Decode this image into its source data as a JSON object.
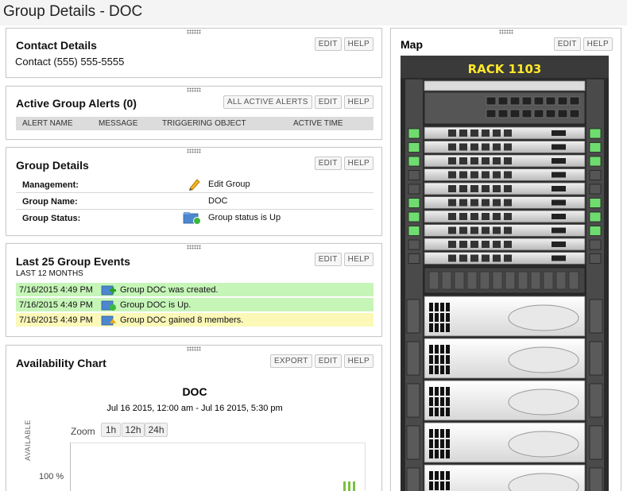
{
  "page": {
    "title": "Group Details - DOC"
  },
  "contact": {
    "title": "Contact Details",
    "edit_label": "EDIT",
    "help_label": "HELP",
    "line": "Contact (555) 555-5555"
  },
  "alerts": {
    "title": "Active Group Alerts (0)",
    "all_label": "ALL ACTIVE ALERTS",
    "edit_label": "EDIT",
    "help_label": "HELP",
    "columns": [
      "ALERT NAME",
      "MESSAGE",
      "TRIGGERING OBJECT",
      "ACTIVE TIME"
    ]
  },
  "group_details": {
    "title": "Group Details",
    "edit_label": "EDIT",
    "help_label": "HELP",
    "rows": [
      {
        "label": "Management:",
        "value": "Edit Group",
        "icon": "pencil-icon"
      },
      {
        "label": "Group Name:",
        "value": "DOC",
        "icon": ""
      },
      {
        "label": "Group Status:",
        "value": "Group status is Up",
        "icon": "group-status-up-icon"
      }
    ]
  },
  "events": {
    "title": "Last 25 Group Events",
    "edit_label": "EDIT",
    "help_label": "HELP",
    "subtitle": "LAST 12 MONTHS",
    "rows": [
      {
        "time": "7/16/2015 4:49 PM",
        "message": "Group DOC was created.",
        "color": "#c6f5b8",
        "icon": "group-created-icon"
      },
      {
        "time": "7/16/2015 4:49 PM",
        "message": "Group DOC is Up.",
        "color": "#c6f5b8",
        "icon": "group-up-icon"
      },
      {
        "time": "7/16/2015 4:49 PM",
        "message": "Group DOC gained 8 members.",
        "color": "#fbf8b8",
        "icon": "group-members-icon"
      }
    ]
  },
  "availability": {
    "title": "Availability Chart",
    "export_label": "EXPORT",
    "edit_label": "EDIT",
    "help_label": "HELP",
    "chart_title": "DOC",
    "range": "Jul 16 2015, 12:00 am - Jul 16 2015, 5:30 pm",
    "zoom_label": "Zoom",
    "zoom_options": [
      "1h",
      "12h",
      "24h"
    ],
    "y_tick": "100 %",
    "y_label": "AVAILABLE",
    "bar_color": "#7bc043"
  },
  "map": {
    "title": "Map",
    "edit_label": "EDIT",
    "help_label": "HELP",
    "rack_label": "RACK 1103"
  }
}
